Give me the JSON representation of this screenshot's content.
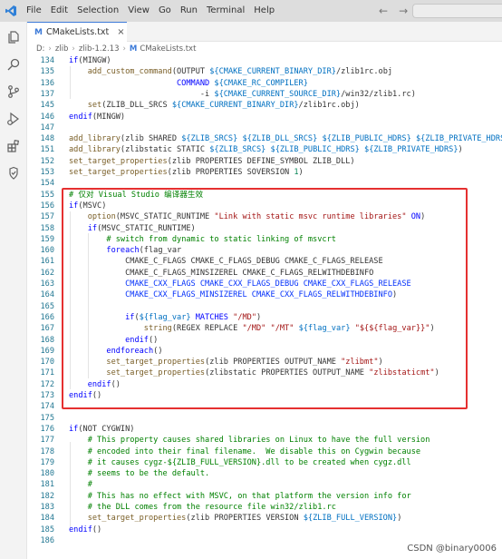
{
  "menu": {
    "file": "File",
    "edit": "Edit",
    "selection": "Selection",
    "view": "View",
    "go": "Go",
    "run": "Run",
    "terminal": "Terminal",
    "help": "Help"
  },
  "tab": {
    "label": "CMakeLists.txt",
    "icon": "M"
  },
  "breadcrumb": {
    "drive": "D:",
    "dir1": "zlib",
    "dir2": "zlib-1.2.13",
    "file": "CMakeLists.txt"
  },
  "lines": [
    {
      "n": "134",
      "html": "<span class=\"k\">if</span>(MINGW)"
    },
    {
      "n": "135",
      "html": "    <span class=\"f\">add_custom_command</span>(OUTPUT <span class=\"v\">${CMAKE_CURRENT_BINARY_DIR}</span>/zlib1rc.obj"
    },
    {
      "n": "136",
      "html": "                       <span class=\"k\">COMMAND</span> <span class=\"v\">${CMAKE_RC_COMPILER}</span>"
    },
    {
      "n": "137",
      "html": "                            -i <span class=\"v\">${CMAKE_CURRENT_SOURCE_DIR}</span>/win32/zlib1.rc)"
    },
    {
      "n": "145",
      "html": "    <span class=\"f\">set</span>(ZLIB_DLL_SRCS <span class=\"v\">${CMAKE_CURRENT_BINARY_DIR}</span>/zlib1rc.obj)"
    },
    {
      "n": "146",
      "html": "<span class=\"k\">endif</span>(MINGW)"
    },
    {
      "n": "147",
      "html": ""
    },
    {
      "n": "148",
      "html": "<span class=\"f\">add_library</span>(zlib SHARED <span class=\"v\">${ZLIB_SRCS}</span> <span class=\"v\">${ZLIB_DLL_SRCS}</span> <span class=\"v\">${ZLIB_PUBLIC_HDRS}</span> <span class=\"v\">${ZLIB_PRIVATE_HDRS}</span>)"
    },
    {
      "n": "151",
      "html": "<span class=\"f\">add_library</span>(zlibstatic STATIC <span class=\"v\">${ZLIB_SRCS}</span> <span class=\"v\">${ZLIB_PUBLIC_HDRS}</span> <span class=\"v\">${ZLIB_PRIVATE_HDRS}</span>)"
    },
    {
      "n": "152",
      "html": "<span class=\"f\">set_target_properties</span>(zlib PROPERTIES DEFINE_SYMBOL ZLIB_DLL)"
    },
    {
      "n": "153",
      "html": "<span class=\"f\">set_target_properties</span>(zlib PROPERTIES SOVERSION <span class=\"n\">1</span>)"
    },
    {
      "n": "154",
      "html": ""
    },
    {
      "n": "155",
      "html": "<span class=\"c\"># 仅对 Visual Studio 编译器生效</span>"
    },
    {
      "n": "156",
      "html": "<span class=\"k\">if</span>(MSVC)"
    },
    {
      "n": "157",
      "html": "    <span class=\"f\">option</span>(MSVC_STATIC_RUNTIME <span class=\"s\">\"Link with static msvc runtime libraries\"</span> <span class=\"k\">ON</span>)"
    },
    {
      "n": "158",
      "html": "    <span class=\"k\">if</span>(MSVC_STATIC_RUNTIME)"
    },
    {
      "n": "159",
      "html": "        <span class=\"c\"># switch from dynamic to static linking of msvcrt</span>"
    },
    {
      "n": "160",
      "html": "        <span class=\"k\">foreach</span>(flag_var"
    },
    {
      "n": "161",
      "html": "            CMAKE_C_FLAGS CMAKE_C_FLAGS_DEBUG CMAKE_C_FLAGS_RELEASE"
    },
    {
      "n": "162",
      "html": "            CMAKE_C_FLAGS_MINSIZEREL CMAKE_C_FLAGS_RELWITHDEBINFO"
    },
    {
      "n": "163",
      "html": "            <span class=\"p\">CMAKE_CXX_FLAGS CMAKE_CXX_FLAGS_DEBUG CMAKE_CXX_FLAGS_RELEASE</span>"
    },
    {
      "n": "164",
      "html": "            <span class=\"p\">CMAKE_CXX_FLAGS_MINSIZEREL CMAKE_CXX_FLAGS_RELWITHDEBINFO</span>)"
    },
    {
      "n": "165",
      "html": ""
    },
    {
      "n": "166",
      "html": "            <span class=\"k\">if</span>(<span class=\"v\">${flag_var}</span> <span class=\"k\">MATCHES</span> <span class=\"s\">\"/MD\"</span>)"
    },
    {
      "n": "167",
      "html": "                <span class=\"f\">string</span>(REGEX REPLACE <span class=\"s\">\"/MD\"</span> <span class=\"s\">\"/MT\"</span> <span class=\"v\">${flag_var}</span> <span class=\"s\">\"${${flag_var}}\"</span>)"
    },
    {
      "n": "168",
      "html": "            <span class=\"k\">endif</span>()"
    },
    {
      "n": "169",
      "html": "        <span class=\"k\">endforeach</span>()"
    },
    {
      "n": "170",
      "html": "        <span class=\"f\">set_target_properties</span>(zlib PROPERTIES OUTPUT_NAME <span class=\"s\">\"zlibmt\"</span>)"
    },
    {
      "n": "171",
      "html": "        <span class=\"f\">set_target_properties</span>(zlibstatic PROPERTIES OUTPUT_NAME <span class=\"s\">\"zlibstaticmt\"</span>)"
    },
    {
      "n": "172",
      "html": "    <span class=\"k\">endif</span>()"
    },
    {
      "n": "173",
      "html": "<span class=\"k\">endif</span>()"
    },
    {
      "n": "174",
      "html": ""
    },
    {
      "n": "175",
      "html": ""
    },
    {
      "n": "176",
      "html": "<span class=\"k\">if</span>(NOT CYGWIN)"
    },
    {
      "n": "177",
      "html": "    <span class=\"c\"># This property causes shared libraries on Linux to have the full version</span>"
    },
    {
      "n": "178",
      "html": "    <span class=\"c\"># encoded into their final filename.  We disable this on Cygwin because</span>"
    },
    {
      "n": "179",
      "html": "    <span class=\"c\"># it causes cygz-${ZLIB_FULL_VERSION}.dll to be created when cygz.dll</span>"
    },
    {
      "n": "180",
      "html": "    <span class=\"c\"># seems to be the default.</span>"
    },
    {
      "n": "181",
      "html": "    <span class=\"c\">#</span>"
    },
    {
      "n": "182",
      "html": "    <span class=\"c\"># This has no effect with MSVC, on that platform the version info for</span>"
    },
    {
      "n": "183",
      "html": "    <span class=\"c\"># the DLL comes from the resource file win32/zlib1.rc</span>"
    },
    {
      "n": "184",
      "html": "    <span class=\"f\">set_target_properties</span>(zlib PROPERTIES VERSION <span class=\"v\">${ZLIB_FULL_VERSION}</span>)"
    },
    {
      "n": "185",
      "html": "<span class=\"k\">endif</span>()"
    },
    {
      "n": "186",
      "html": ""
    }
  ],
  "watermark": "CSDN @binary0006"
}
